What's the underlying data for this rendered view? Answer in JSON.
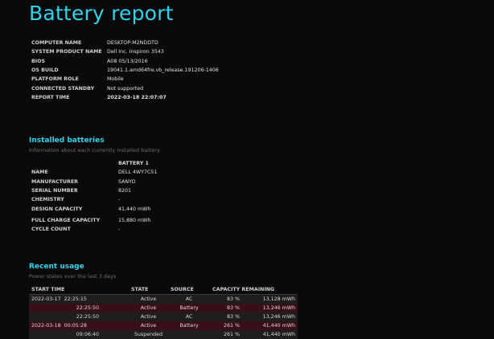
{
  "title": "Battery report",
  "system": [
    {
      "label": "COMPUTER NAME",
      "value": "DESKTOP-M2NDDTD"
    },
    {
      "label": "SYSTEM PRODUCT NAME",
      "value": "Dell Inc. Inspiron 3543"
    },
    {
      "label": "BIOS",
      "value": "A08 05/13/2016"
    },
    {
      "label": "OS BUILD",
      "value": "19041.1.amd64fre.vb_release.191206-1406"
    },
    {
      "label": "PLATFORM ROLE",
      "value": "Mobile"
    },
    {
      "label": "CONNECTED STANDBY",
      "value": "Not supported"
    },
    {
      "label": "REPORT TIME",
      "value": "2022-03-18  22:07:07"
    }
  ],
  "installed": {
    "title": "Installed batteries",
    "subtitle": "Information about each currently installed battery",
    "header": "BATTERY 1",
    "rows": [
      {
        "label": "NAME",
        "value": "DELL 4WY7C51"
      },
      {
        "label": "MANUFACTURER",
        "value": "SANYO"
      },
      {
        "label": "SERIAL NUMBER",
        "value": "8201"
      },
      {
        "label": "CHEMISTRY",
        "value": "-"
      },
      {
        "label": "DESIGN CAPACITY",
        "value": "41,440 mWh"
      },
      {
        "label": "FULL CHARGE CAPACITY",
        "value": "15,880 mWh"
      },
      {
        "label": "CYCLE COUNT",
        "value": "-"
      }
    ]
  },
  "recent": {
    "title": "Recent usage",
    "subtitle": "Power states over the last 3 days",
    "columns": [
      "START TIME",
      "STATE",
      "SOURCE",
      "CAPACITY REMAINING"
    ],
    "rows": [
      {
        "date": "2022-03-17",
        "time": "22:25:15",
        "state": "Active",
        "source": "AC",
        "pct": "83 %",
        "mwh": "13,128 mWh"
      },
      {
        "date": "",
        "time": "22:25:50",
        "state": "Active",
        "source": "Battery",
        "pct": "83 %",
        "mwh": "13,246 mWh"
      },
      {
        "date": "",
        "time": "22:25:50",
        "state": "Active",
        "source": "AC",
        "pct": "83 %",
        "mwh": "13,246 mWh"
      },
      {
        "date": "2022-03-18",
        "time": "00:05:28",
        "state": "Active",
        "source": "Battery",
        "pct": "261 %",
        "mwh": "41,440 mWh"
      },
      {
        "date": "",
        "time": "09:06:40",
        "state": "Suspended",
        "source": "",
        "pct": "261 %",
        "mwh": "41,440 mWh"
      }
    ]
  }
}
